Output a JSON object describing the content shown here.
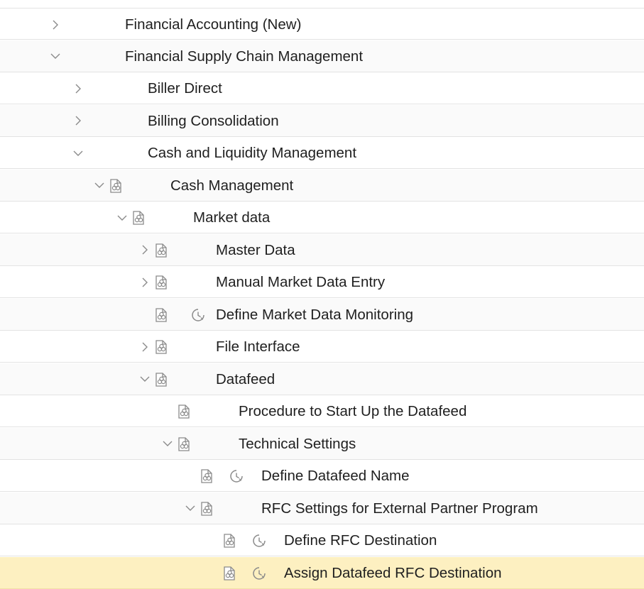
{
  "colors": {
    "selected_row": "#fdf0c1",
    "text": "#1f1f1f",
    "icon": "#8a8a8a"
  },
  "tree": [
    {
      "label": "Financial Accounting (New)",
      "state": "collapsed",
      "doc_icon": false,
      "exec_icon": false
    },
    {
      "label": "Financial Supply Chain Management",
      "state": "expanded",
      "doc_icon": false,
      "exec_icon": false
    },
    {
      "label": "Biller Direct",
      "state": "collapsed",
      "doc_icon": false,
      "exec_icon": false
    },
    {
      "label": "Billing Consolidation",
      "state": "collapsed",
      "doc_icon": false,
      "exec_icon": false
    },
    {
      "label": "Cash and Liquidity Management",
      "state": "expanded",
      "doc_icon": false,
      "exec_icon": false
    },
    {
      "label": "Cash Management",
      "state": "expanded",
      "doc_icon": true,
      "exec_icon": false
    },
    {
      "label": "Market data",
      "state": "expanded",
      "doc_icon": true,
      "exec_icon": false
    },
    {
      "label": "Master Data",
      "state": "collapsed",
      "doc_icon": true,
      "exec_icon": false
    },
    {
      "label": "Manual Market Data Entry",
      "state": "collapsed",
      "doc_icon": true,
      "exec_icon": false
    },
    {
      "label": "Define Market Data Monitoring",
      "state": "leaf",
      "doc_icon": true,
      "exec_icon": true
    },
    {
      "label": "File Interface",
      "state": "collapsed",
      "doc_icon": true,
      "exec_icon": false
    },
    {
      "label": "Datafeed",
      "state": "expanded",
      "doc_icon": true,
      "exec_icon": false
    },
    {
      "label": "Procedure to Start Up the Datafeed",
      "state": "leaf",
      "doc_icon": true,
      "exec_icon": false
    },
    {
      "label": "Technical Settings",
      "state": "expanded",
      "doc_icon": true,
      "exec_icon": false
    },
    {
      "label": "Define Datafeed Name",
      "state": "leaf",
      "doc_icon": true,
      "exec_icon": true
    },
    {
      "label": "RFC Settings for External Partner Program",
      "state": "expanded",
      "doc_icon": true,
      "exec_icon": false
    },
    {
      "label": "Define RFC Destination",
      "state": "leaf",
      "doc_icon": true,
      "exec_icon": true
    },
    {
      "label": "Assign Datafeed RFC Destination",
      "state": "leaf",
      "doc_icon": true,
      "exec_icon": true,
      "selected": true
    }
  ]
}
